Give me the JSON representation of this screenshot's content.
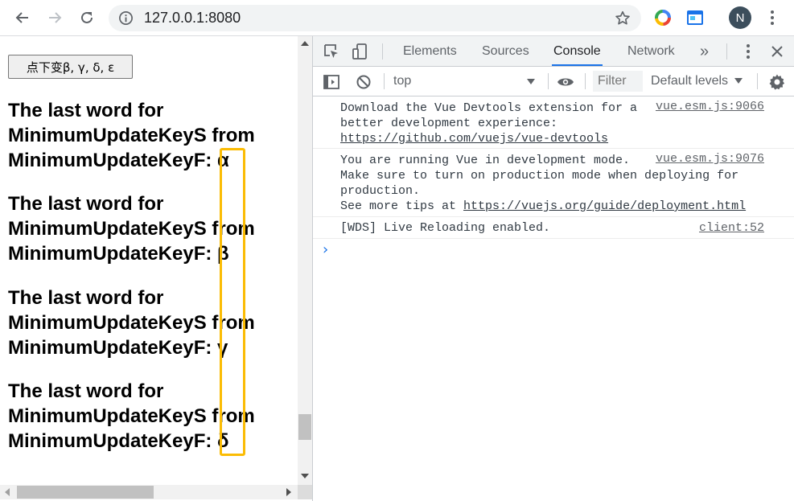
{
  "browser": {
    "url": "127.0.0.1:8080",
    "avatar_initial": "N"
  },
  "page": {
    "button_label": "点下变β, γ, δ, ε",
    "blocks": [
      {
        "line1": "The last word for",
        "line2": "MinimumUpdateKeyS from",
        "line3_prefix": "MinimumUpdateKeyF:",
        "letter": "α"
      },
      {
        "line1": "The last word for",
        "line2": "MinimumUpdateKeyS from",
        "line3_prefix": "MinimumUpdateKeyF:",
        "letter": "β"
      },
      {
        "line1": "The last word for",
        "line2": "MinimumUpdateKeyS from",
        "line3_prefix": "MinimumUpdateKeyF:",
        "letter": "γ"
      },
      {
        "line1": "The last word for",
        "line2": "MinimumUpdateKeyS from",
        "line3_prefix": "MinimumUpdateKeyF:",
        "letter": "δ"
      }
    ],
    "highlight_color": "#fbbc04"
  },
  "devtools": {
    "tabs": [
      "Elements",
      "Sources",
      "Console",
      "Network"
    ],
    "active_tab": "Console",
    "more_tabs": "»",
    "context": "top",
    "filter_placeholder": "Filter",
    "levels": "Default levels",
    "messages": [
      {
        "lines": [
          "Download the Vue Devtools extension for a",
          "better development experience:"
        ],
        "link": "https://github.com/vuejs/vue-devtools",
        "source": "vue.esm.js:9066"
      },
      {
        "lines": [
          "You are running Vue in development mode.",
          "Make sure to turn on production mode when deploying for",
          "production.",
          "See more tips at "
        ],
        "link": "https://vuejs.org/guide/deployment.html",
        "source": "vue.esm.js:9076"
      },
      {
        "lines": [
          "[WDS] Live Reloading enabled."
        ],
        "source": "client:52"
      }
    ],
    "prompt_symbol": "›",
    "accent_color": "#1a73e8"
  }
}
